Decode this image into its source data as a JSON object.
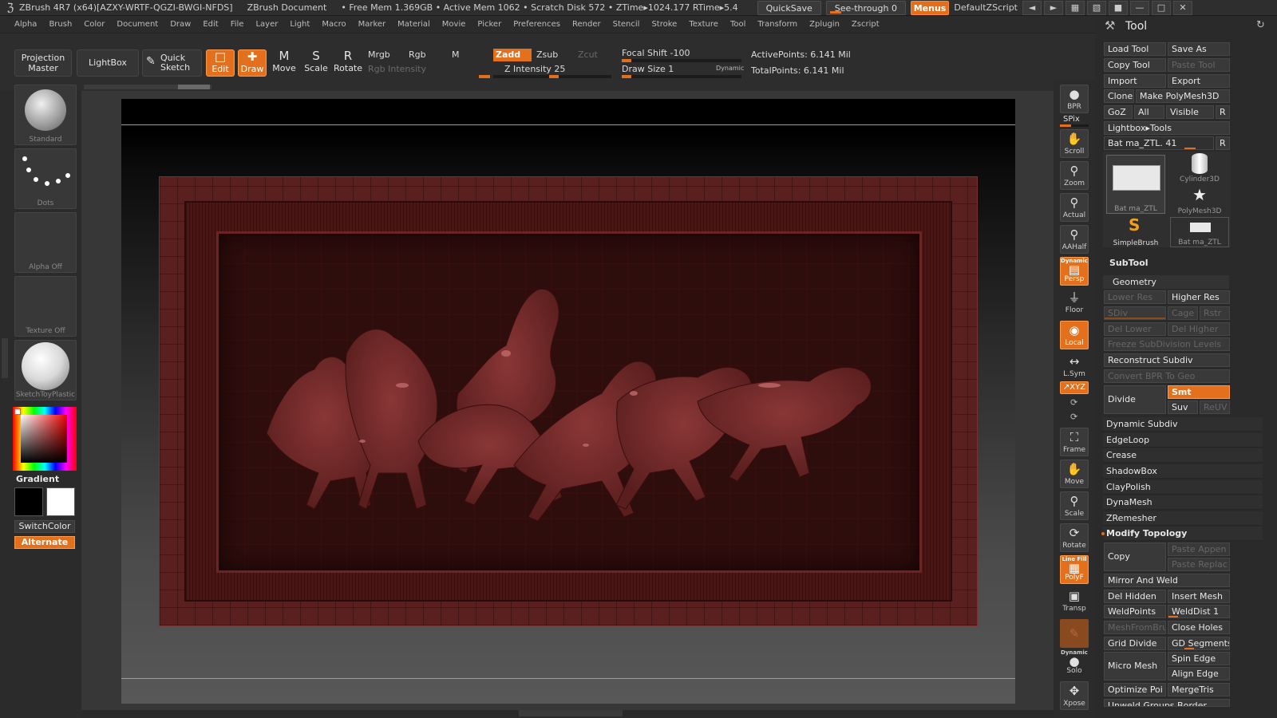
{
  "titlebar": {
    "app": "ZBrush 4R7 (x64)[AZXY-WRTF-QGZI-BWGI-NFDS]",
    "doc": "ZBrush Document",
    "stats": "• Free Mem 1.369GB • Active Mem 1062 • Scratch Disk 572 •  ZTime▸1024.177 RTime▸5.4",
    "quicksave": "QuickSave",
    "seethrough": "See-through  0",
    "menus": "Menus",
    "defaultzscript": "DefaultZScript"
  },
  "menubar": [
    "Alpha",
    "Brush",
    "Color",
    "Document",
    "Draw",
    "Edit",
    "File",
    "Layer",
    "Light",
    "Macro",
    "Marker",
    "Material",
    "Movie",
    "Picker",
    "Preferences",
    "Render",
    "Stencil",
    "Stroke",
    "Texture",
    "Tool",
    "Transform",
    "Zplugin",
    "Zscript"
  ],
  "shelf": {
    "projection_master": "Projection Master",
    "lightbox": "LightBox",
    "quick_sketch": "Quick Sketch",
    "edit": "Edit",
    "draw": "Draw",
    "move": "Move",
    "scale": "Scale",
    "rotate": "Rotate",
    "mrgb": "Mrgb",
    "rgb": "Rgb",
    "m": "M",
    "rgb_intensity": "Rgb  Intensity",
    "zadd": "Zadd",
    "zsub": "Zsub",
    "zcut": "Zcut",
    "z_intensity": "Z Intensity 25",
    "focal_shift": "Focal  Shift -100",
    "draw_size": "Draw  Size 1",
    "dynamic": "Dynamic",
    "active_points": "ActivePoints: 6.141  Mil",
    "total_points": "TotalPoints: 6.141  Mil"
  },
  "left": {
    "brush": "Standard",
    "stroke": "Dots",
    "alpha": "Alpha  Off",
    "texture": "Texture  Off",
    "material": "SketchToyPlastic",
    "gradient": "Gradient",
    "switchcolor": "SwitchColor",
    "alternate": "Alternate"
  },
  "rtool": {
    "bpr": "BPR",
    "spix": "SPix",
    "scroll": "Scroll",
    "zoom": "Zoom",
    "actual": "Actual",
    "aahalf": "AAHalf",
    "dynamic": "Dynamic",
    "persp": "Persp",
    "floor": "Floor",
    "local": "Local",
    "lsym": "L.Sym",
    "xyz": "↗XYZ",
    "frame": "Frame",
    "move": "Move",
    "scale": "Scale",
    "rotate": "Rotate",
    "linefill": "Line Fill",
    "polyf": "PolyF",
    "transp": "Transp",
    "ghost": "Ghost",
    "dynamic2": "Dynamic",
    "solo": "Solo",
    "xpose": "Xpose"
  },
  "toolpanel": {
    "title": "Tool",
    "load_tool": "Load Tool",
    "save_as": "Save As",
    "copy_tool": "Copy Tool",
    "paste_tool": "Paste Tool",
    "import": "Import",
    "export": "Export",
    "clone": "Clone",
    "make_polymesh": "Make PolyMesh3D",
    "goz": "GoZ",
    "all": "All",
    "visible": "Visible",
    "r": "R",
    "lightbox_tools": "Lightbox▸Tools",
    "current_tool": "Bat ma_ZTL. 41",
    "thumbs": [
      "Bat ma_ZTL",
      "Cylinder3D",
      "PolyMesh3D",
      "SimpleBrush",
      "Bat ma_ZTL"
    ],
    "subtool": "SubTool",
    "geometry": "Geometry",
    "lower_res": "Lower Res",
    "higher_res": "Higher Res",
    "sdiv": "SDiv",
    "cage": "Cage",
    "rstr": "Rstr",
    "del_lower": "Del Lower",
    "del_higher": "Del Higher",
    "freeze": "Freeze SubDivision Levels",
    "reconstruct": "Reconstruct Subdiv",
    "convert_bpr": "Convert BPR To Geo",
    "divide": "Divide",
    "smt": "Smt",
    "suv": "Suv",
    "reuv": "ReUV",
    "rows": [
      "Dynamic Subdiv",
      "EdgeLoop",
      "Crease",
      "ShadowBox",
      "ClayPolish",
      "DynaMesh",
      "ZRemesher"
    ],
    "modify_topology": "Modify Topology",
    "copy": "Copy",
    "paste_append": "Paste Appen",
    "paste_replace": "Paste Replac",
    "mirror_weld": "Mirror And Weld",
    "del_hidden": "Del Hidden",
    "insert_mesh": "Insert Mesh",
    "weldpoints": "WeldPoints",
    "welddist": "WeldDist 1",
    "meshfrombrush": "MeshFromBru",
    "close_holes": "Close Holes",
    "grid_divide": "Grid Divide",
    "gd_segments": "GD Segments",
    "micro_mesh": "Micro Mesh",
    "spin_edge": "Spin Edge",
    "align_edge": "Align Edge",
    "optimize_points": "Optimize Poi",
    "mergetris": "MergeTris",
    "unweld": "Unweld Groups Border"
  }
}
